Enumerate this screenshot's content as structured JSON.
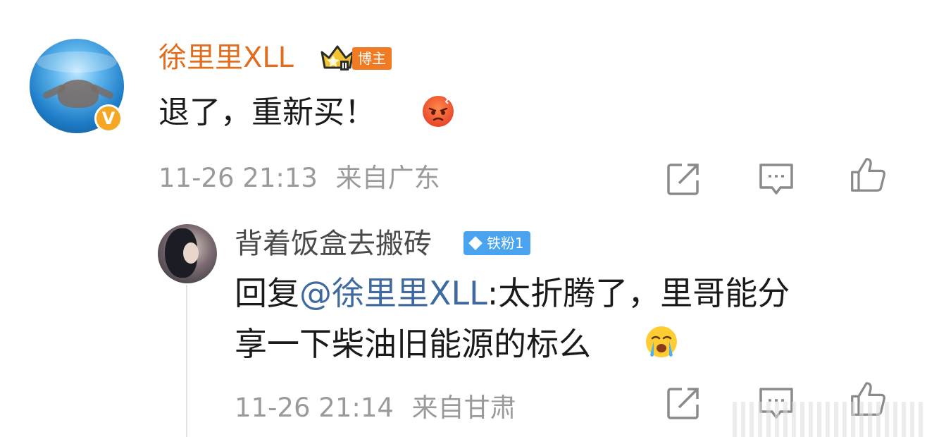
{
  "comment": {
    "user_name": "徐里里XLL",
    "badge": "博主",
    "text": "退了，重新买！",
    "emoji": "angry-face-emoji",
    "time": "11-26 21:13",
    "location": "来自广东",
    "verified_icon": "V"
  },
  "reply": {
    "user_name": "背着饭盒去搬砖",
    "fan_badge": "铁粉1",
    "prefix": "回复",
    "mention": "@徐里里XLL",
    "text_part1": ":太折腾了，里哥能分",
    "text_part2": "享一下柴油旧能源的标么",
    "emoji": "crying-face-emoji",
    "time": "11-26 21:14",
    "location": "来自甘肃"
  },
  "colors": {
    "username_orange": "#e06e1e",
    "mention_blue": "#3f6aa0",
    "meta_gray": "#9a9a9a",
    "fan_badge_blue": "#4aa3ef",
    "bozhu_tag": "#f07b22"
  }
}
